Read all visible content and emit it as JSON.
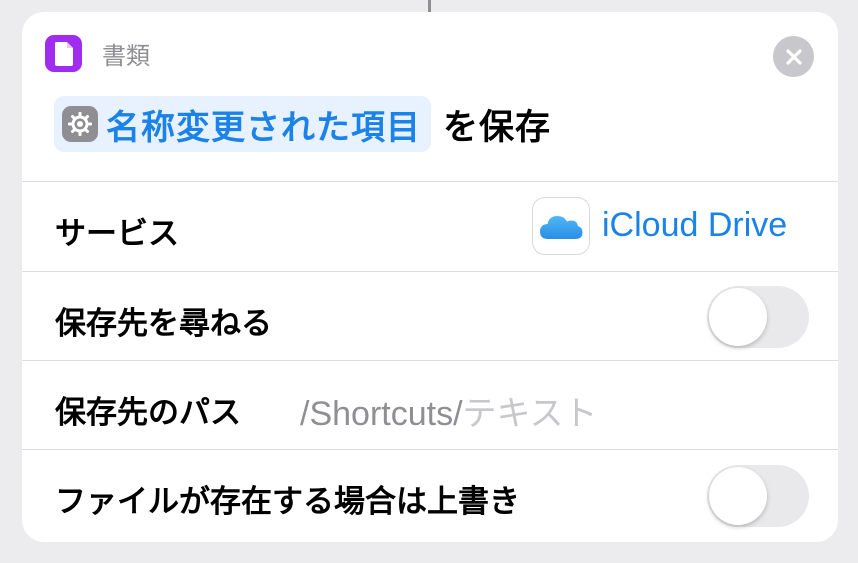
{
  "header": {
    "app_name": "書類",
    "variable_label": "名称変更された項目",
    "action_suffix": "を保存"
  },
  "rows": {
    "service": {
      "label": "サービス",
      "value": "iCloud Drive"
    },
    "ask_destination": {
      "label": "保存先を尋ねる",
      "toggle_on": false
    },
    "destination_path": {
      "label": "保存先のパス",
      "prefix": "/Shortcuts/",
      "placeholder": "テキスト"
    },
    "overwrite": {
      "label": "ファイルが存在する場合は上書き",
      "toggle_on": false
    }
  },
  "icons": {
    "app": "document-icon",
    "close": "close-icon",
    "variable": "gear-icon",
    "service": "icloud-icon"
  },
  "colors": {
    "accent": "#1a82e8",
    "app_icon": "#a02cf0",
    "toggle_off": "#e9e9eb",
    "background": "#ececef"
  }
}
